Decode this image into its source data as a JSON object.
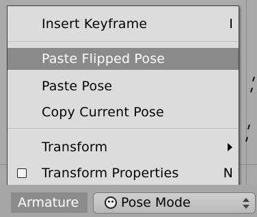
{
  "menu": {
    "items": [
      {
        "label": "Insert Keyframe",
        "shortcut": "I"
      },
      {
        "label": "Paste Flipped Pose",
        "shortcut": ""
      },
      {
        "label": "Paste Pose",
        "shortcut": ""
      },
      {
        "label": "Copy Current Pose",
        "shortcut": ""
      },
      {
        "label": "Transform",
        "shortcut": ""
      },
      {
        "label": "Transform Properties",
        "shortcut": "N"
      }
    ]
  },
  "header": {
    "menu_button_label": "Armature",
    "mode_select_value": "Pose Mode"
  },
  "colors": {
    "menu_background": "#dcdcdc",
    "highlight": "#8a8a8a",
    "header": "#a6a6a6"
  }
}
